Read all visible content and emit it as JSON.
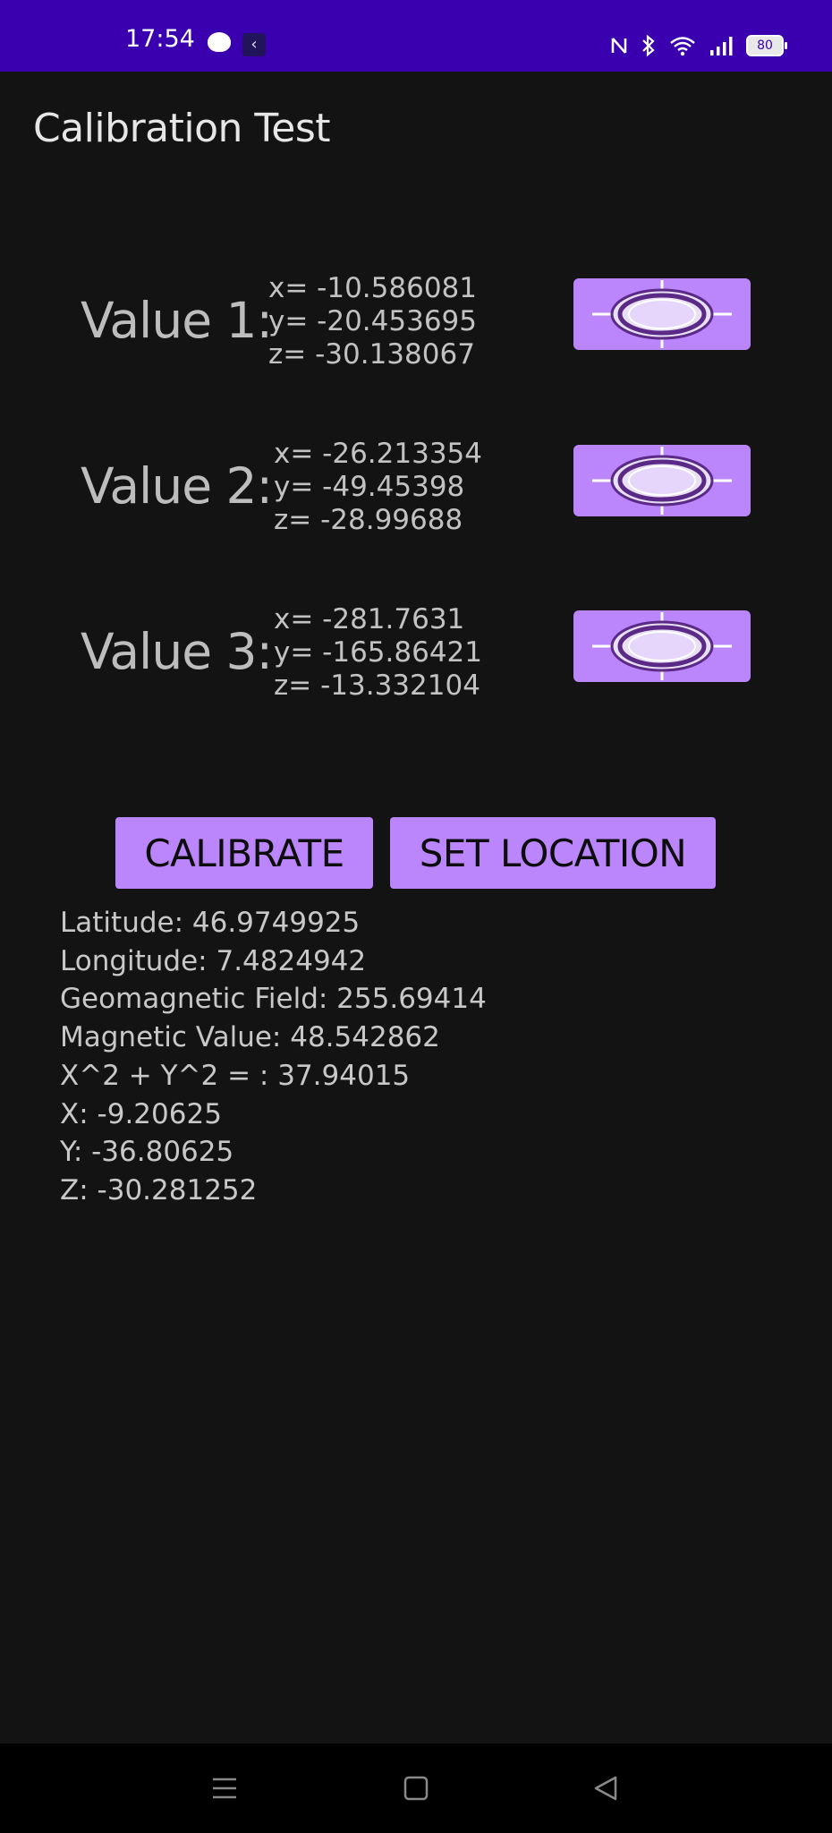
{
  "status_bar": {
    "time": "17:54",
    "battery_level": "80",
    "icons": [
      "nfc-icon",
      "bluetooth-icon",
      "wifi-icon",
      "signal-icon",
      "battery-icon"
    ]
  },
  "app": {
    "title": "Calibration Test"
  },
  "values": [
    {
      "label": "Value 1:",
      "x": "x= -10.586081",
      "y": "y= -20.453695",
      "z": "z= -30.138067"
    },
    {
      "label": "Value 2:",
      "x": "x= -26.213354",
      "y": "y= -49.45398",
      "z": "z= -28.99688"
    },
    {
      "label": "Value 3:",
      "x": "x= -281.7631",
      "y": "y= -165.86421",
      "z": "z= -13.332104"
    }
  ],
  "buttons": {
    "calibrate": "CALIBRATE",
    "set_location": "SET LOCATION"
  },
  "info": {
    "latitude": "Latitude: 46.9749925",
    "longitude": "Longitude: 7.4824942",
    "geomagnetic": "Geomagnetic Field: 255.69414",
    "magnetic": "Magnetic Value: 48.542862",
    "xy": "X^2 + Y^2 = : 37.94015",
    "x": "X: -9.20625",
    "y": "Y: -36.80625",
    "z": "Z: -30.281252"
  },
  "colors": {
    "status_bar": "#3a00b0",
    "accent": "#bb86fc",
    "background": "#131313"
  }
}
